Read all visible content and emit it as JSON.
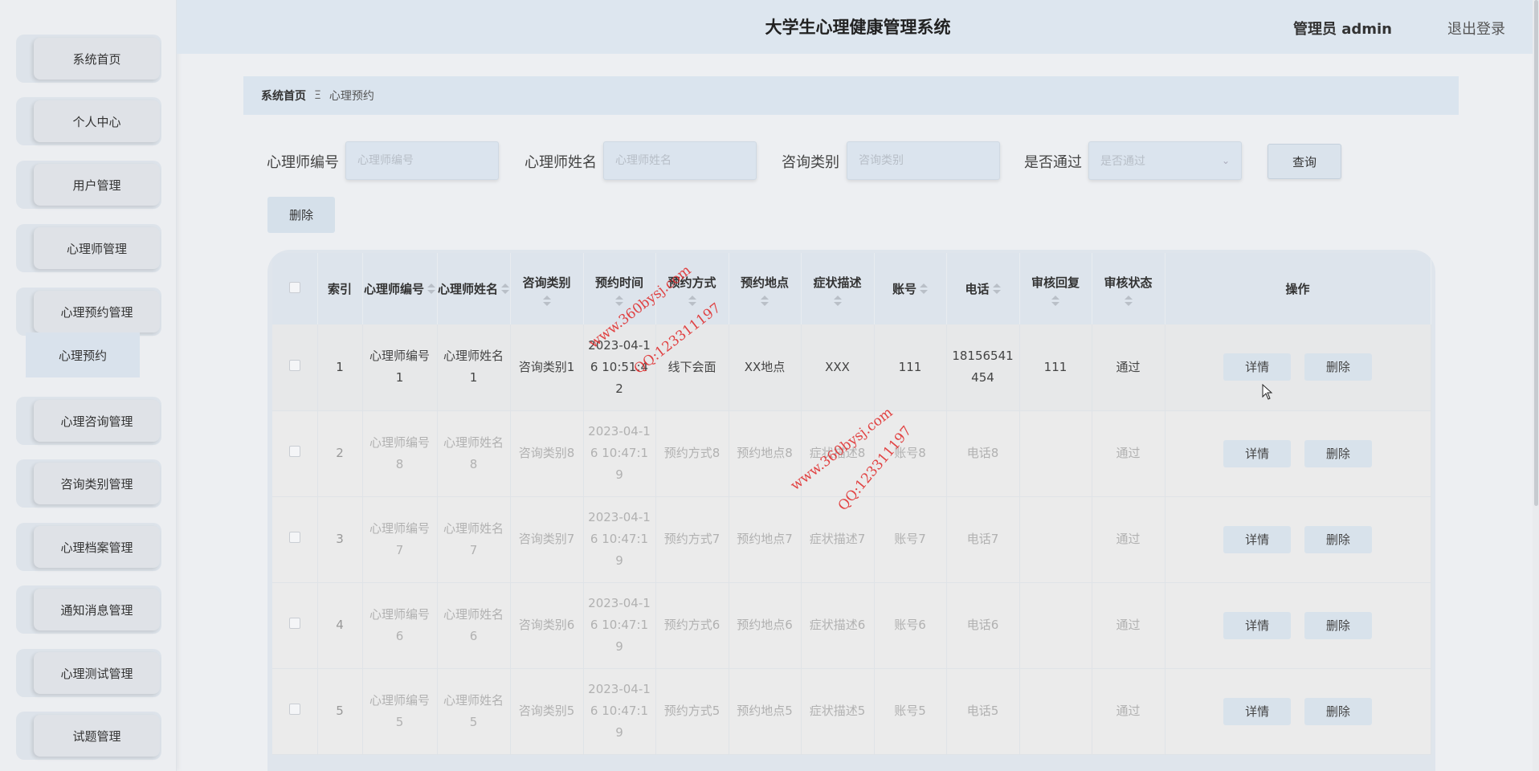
{
  "app": {
    "title": "大学生心理健康管理系统"
  },
  "header": {
    "admin_label": "管理员 admin",
    "logout_label": "退出登录"
  },
  "sidebar": {
    "items": [
      {
        "label": "系统首页"
      },
      {
        "label": "个人中心"
      },
      {
        "label": "用户管理"
      },
      {
        "label": "心理师管理"
      },
      {
        "label": "心理预约管理"
      },
      {
        "label": "心理咨询管理"
      },
      {
        "label": "咨询类别管理"
      },
      {
        "label": "心理档案管理"
      },
      {
        "label": "通知消息管理"
      },
      {
        "label": "心理测试管理"
      },
      {
        "label": "试题管理"
      }
    ],
    "sub_item": {
      "label": "心理预约"
    }
  },
  "breadcrumb": {
    "home": "系统首页",
    "separator": "Ξ",
    "current": "心理预约"
  },
  "search": {
    "fields": [
      {
        "label": "心理师编号",
        "placeholder": "心理师编号"
      },
      {
        "label": "心理师姓名",
        "placeholder": "心理师姓名"
      },
      {
        "label": "咨询类别",
        "placeholder": "咨询类别"
      },
      {
        "label": "是否通过",
        "placeholder": "是否通过"
      }
    ],
    "query_label": "查询",
    "delete_label": "删除"
  },
  "table": {
    "headers": [
      "索引",
      "心理师编号",
      "心理师姓名",
      "咨询类别",
      "预约时间",
      "预约方式",
      "预约地点",
      "症状描述",
      "账号",
      "电话",
      "审核回复",
      "审核状态",
      "操作"
    ],
    "actions": {
      "detail": "详情",
      "delete": "删除"
    },
    "rows": [
      {
        "index": "1",
        "code": "心理师编号1",
        "name": "心理师姓名1",
        "category": "咨询类别1",
        "time": "2023-04-16 10:51:42",
        "method": "线下会面",
        "place": "XX地点",
        "symptom": "XXX",
        "account": "111",
        "phone": "18156541454",
        "reply": "111",
        "status": "通过"
      },
      {
        "index": "2",
        "code": "心理师编号8",
        "name": "心理师姓名8",
        "category": "咨询类别8",
        "time": "2023-04-16 10:47:19",
        "method": "预约方式8",
        "place": "预约地点8",
        "symptom": "症状描述8",
        "account": "账号8",
        "phone": "电话8",
        "reply": "",
        "status": "通过"
      },
      {
        "index": "3",
        "code": "心理师编号7",
        "name": "心理师姓名7",
        "category": "咨询类别7",
        "time": "2023-04-16 10:47:19",
        "method": "预约方式7",
        "place": "预约地点7",
        "symptom": "症状描述7",
        "account": "账号7",
        "phone": "电话7",
        "reply": "",
        "status": "通过"
      },
      {
        "index": "4",
        "code": "心理师编号6",
        "name": "心理师姓名6",
        "category": "咨询类别6",
        "time": "2023-04-16 10:47:19",
        "method": "预约方式6",
        "place": "预约地点6",
        "symptom": "症状描述6",
        "account": "账号6",
        "phone": "电话6",
        "reply": "",
        "status": "通过"
      },
      {
        "index": "5",
        "code": "心理师编号5",
        "name": "心理师姓名5",
        "category": "咨询类别5",
        "time": "2023-04-16 10:47:19",
        "method": "预约方式5",
        "place": "预约地点5",
        "symptom": "症状描述5",
        "account": "账号5",
        "phone": "电话5",
        "reply": "",
        "status": "通过"
      }
    ]
  },
  "watermark": {
    "site": "www.360bysj.com",
    "qq": "QQ:123311197"
  },
  "colors": {
    "accent": "#dae4ee",
    "watermark": "#e03030"
  }
}
